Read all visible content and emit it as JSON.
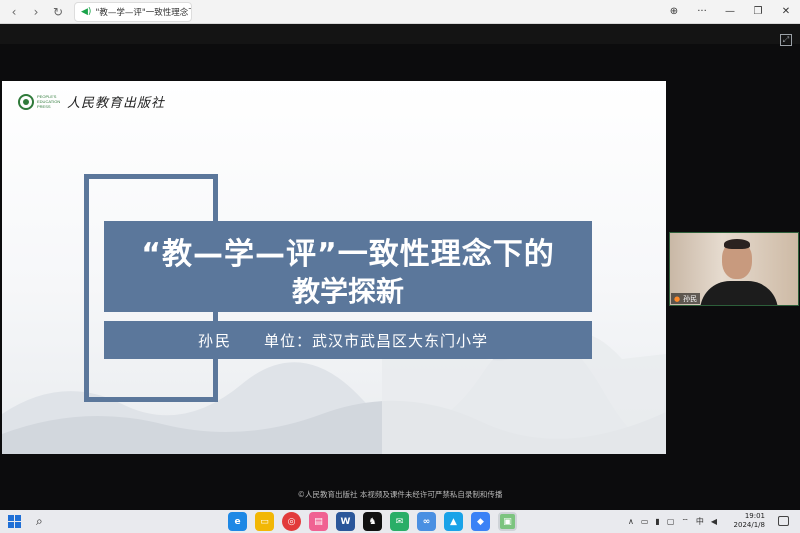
{
  "browser": {
    "tab_title": "\"教—学—评\"一致性理念下的",
    "back_icon": "‹",
    "forward_icon": "›",
    "reload_icon": "↻",
    "sound_icon": "◀)",
    "controls": [
      "⊕",
      "···",
      "—",
      "❐",
      "✕"
    ]
  },
  "slide": {
    "logo_en": "PEOPLE'S EDUCATION PRESS",
    "logo_cn": "人民教育出版社",
    "title_line1": "“教—学—评”一致性理念下的",
    "title_line2": "教学探新",
    "presenter": "孙民",
    "unit": "单位：武汉市武昌区大东门小学",
    "accent_color": "#5b779b"
  },
  "webcam": {
    "name": "孙民"
  },
  "footer": {
    "copyright": "©人民教育出版社 本视频及课件未经许可严禁私自录制和传播"
  },
  "taskbar": {
    "tray_ime": "中",
    "time": "19:01",
    "date": "2024/1/8"
  }
}
